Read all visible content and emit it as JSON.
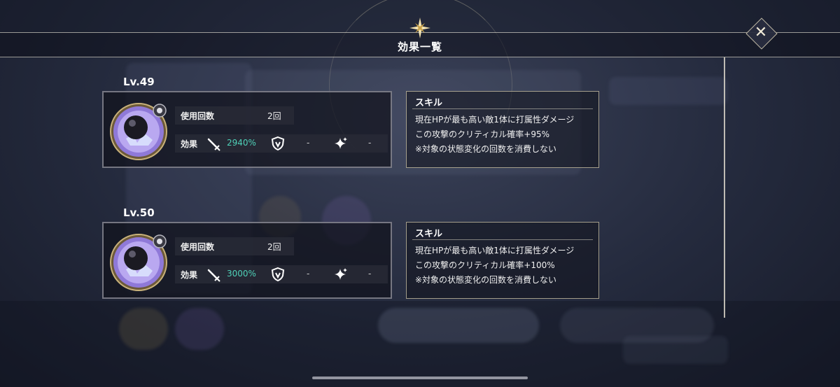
{
  "header": {
    "title": "効果一覧",
    "close_icon": "close-icon"
  },
  "entries": [
    {
      "level": "Lv.49",
      "use_label": "使用回数",
      "use_count": "2回",
      "effect_label": "効果",
      "attack_pct": "2940%",
      "defense": "-",
      "special": "-",
      "skill": {
        "heading": "スキル",
        "line1": "現在HPが最も高い敵1体に打属性ダメージ",
        "line2": "この攻撃のクリティカル確率+95%",
        "line3": "※対象の状態変化の回数を消費しない"
      }
    },
    {
      "level": "Lv.50",
      "use_label": "使用回数",
      "use_count": "2回",
      "effect_label": "効果",
      "attack_pct": "3000%",
      "defense": "-",
      "special": "-",
      "skill": {
        "heading": "スキル",
        "line1": "現在HPが最も高い敵1体に打属性ダメージ",
        "line2": "この攻撃のクリティカル確率+100%",
        "line3": "※対象の状態変化の回数を消費しない"
      }
    }
  ],
  "colors": {
    "accent_teal": "#4fd1b8",
    "gold_border": "#d2c8aa"
  }
}
